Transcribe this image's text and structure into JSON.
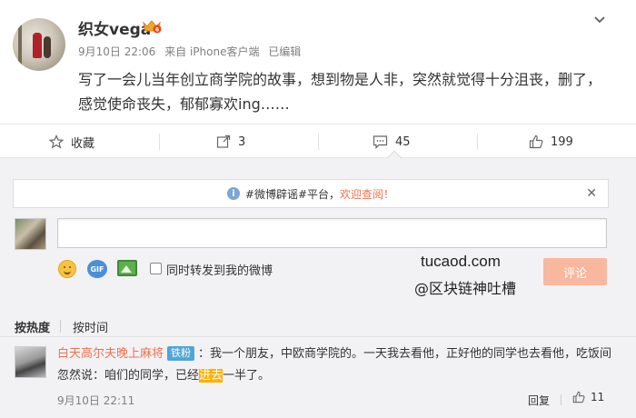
{
  "post": {
    "username": "织女vega",
    "time": "9月10日 22:06",
    "source": "来自 iPhone客户端",
    "edited": "已编辑",
    "text": "写了一会儿当年创立商学院的故事，想到物是人非，突然就觉得十分沮丧，删了，感觉使命丧失，郁郁寡欢ing……"
  },
  "actions": {
    "favorite_label": "收藏",
    "repost_count": "3",
    "comment_count": "45",
    "like_count": "199"
  },
  "notice": {
    "prefix": "#微博辟谣#平台，",
    "link": "欢迎查阅！"
  },
  "composer": {
    "input_value": "",
    "repost_label": "同时转发到我的微博",
    "submit_label": "评论",
    "gif_label": "GIF"
  },
  "watermark": {
    "line1": "tucaod.com",
    "line2": "@区块链神吐槽"
  },
  "sort": {
    "hot": "按热度",
    "time": "按时间"
  },
  "comment": {
    "username": "白天高尔夫晚上麻将",
    "badge": "铁粉",
    "text_before": "：我一个朋友，中欧商学院的。一天我去看他，正好他的同学也去看他，吃饭间忽然说：咱们的同学，已经",
    "highlight": "进去",
    "text_after": "一半了。",
    "time": "9月10日 22:11",
    "reply_label": "回复",
    "like_count": "11"
  },
  "colors": {
    "accent": "#eb7350",
    "badge_blue": "#4fa5d8",
    "highlight": "#ffb000",
    "panel_bg": "#f2f2f5"
  }
}
